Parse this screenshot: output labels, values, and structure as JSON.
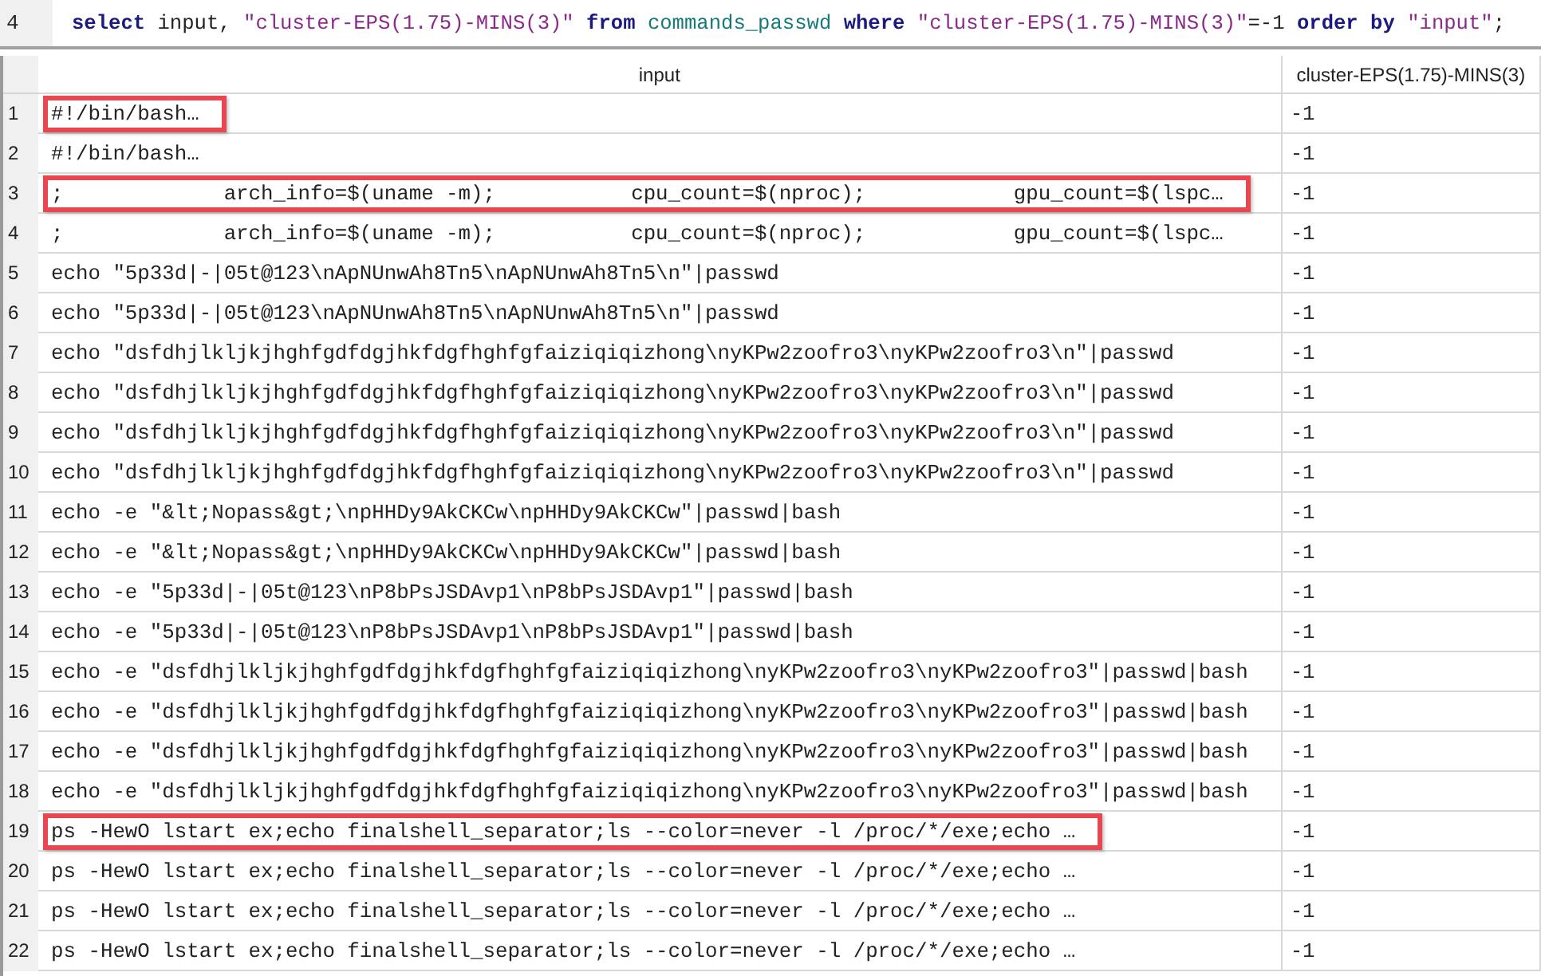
{
  "editor": {
    "line_number": "4",
    "tokens": [
      {
        "kind": "keyword",
        "text": "select"
      },
      {
        "kind": "plain",
        "text": " input, "
      },
      {
        "kind": "string",
        "text": "\"cluster-EPS(1.75)-MINS(3)\""
      },
      {
        "kind": "keyword",
        "text": " from"
      },
      {
        "kind": "ident",
        "text": " commands_passwd"
      },
      {
        "kind": "keyword",
        "text": " where"
      },
      {
        "kind": "string",
        "text": " \"cluster-EPS(1.75)-MINS(3)\""
      },
      {
        "kind": "plain",
        "text": "=-1 "
      },
      {
        "kind": "keyword",
        "text": "order by"
      },
      {
        "kind": "string",
        "text": " \"input\""
      },
      {
        "kind": "plain",
        "text": ";"
      }
    ]
  },
  "table": {
    "columns": [
      "input",
      "cluster-EPS(1.75)-MINS(3)"
    ],
    "rows": [
      {
        "number": "1",
        "input": "#!/bin/bash…",
        "value": "-1",
        "highlighted": true
      },
      {
        "number": "2",
        "input": "#!/bin/bash…",
        "value": "-1",
        "highlighted": false
      },
      {
        "number": "3",
        "input": ";             arch_info=$(uname -m);           cpu_count=$(nproc);            gpu_count=$(lspc…",
        "value": "-1",
        "highlighted": true
      },
      {
        "number": "4",
        "input": ";             arch_info=$(uname -m);           cpu_count=$(nproc);            gpu_count=$(lspc…",
        "value": "-1",
        "highlighted": false
      },
      {
        "number": "5",
        "input": "echo \"5p33d|-|05t@123\\nApNUnwAh8Tn5\\nApNUnwAh8Tn5\\n\"|passwd",
        "value": "-1",
        "highlighted": false
      },
      {
        "number": "6",
        "input": "echo \"5p33d|-|05t@123\\nApNUnwAh8Tn5\\nApNUnwAh8Tn5\\n\"|passwd",
        "value": "-1",
        "highlighted": false
      },
      {
        "number": "7",
        "input": "echo \"dsfdhjlkljkjhghfgdfdgjhkfdgfhghfgfaiziqiqizhong\\nyKPw2zoofro3\\nyKPw2zoofro3\\n\"|passwd",
        "value": "-1",
        "highlighted": false
      },
      {
        "number": "8",
        "input": "echo \"dsfdhjlkljkjhghfgdfdgjhkfdgfhghfgfaiziqiqizhong\\nyKPw2zoofro3\\nyKPw2zoofro3\\n\"|passwd",
        "value": "-1",
        "highlighted": false
      },
      {
        "number": "9",
        "input": "echo \"dsfdhjlkljkjhghfgdfdgjhkfdgfhghfgfaiziqiqizhong\\nyKPw2zoofro3\\nyKPw2zoofro3\\n\"|passwd",
        "value": "-1",
        "highlighted": false
      },
      {
        "number": "10",
        "input": "echo \"dsfdhjlkljkjhghfgdfdgjhkfdgfhghfgfaiziqiqizhong\\nyKPw2zoofro3\\nyKPw2zoofro3\\n\"|passwd",
        "value": "-1",
        "highlighted": false
      },
      {
        "number": "11",
        "input": "echo -e \"&lt;Nopass&gt;\\npHHDy9AkCKCw\\npHHDy9AkCKCw\"|passwd|bash",
        "value": "-1",
        "highlighted": false
      },
      {
        "number": "12",
        "input": "echo -e \"&lt;Nopass&gt;\\npHHDy9AkCKCw\\npHHDy9AkCKCw\"|passwd|bash",
        "value": "-1",
        "highlighted": false
      },
      {
        "number": "13",
        "input": "echo -e \"5p33d|-|05t@123\\nP8bPsJSDAvp1\\nP8bPsJSDAvp1\"|passwd|bash",
        "value": "-1",
        "highlighted": false
      },
      {
        "number": "14",
        "input": "echo -e \"5p33d|-|05t@123\\nP8bPsJSDAvp1\\nP8bPsJSDAvp1\"|passwd|bash",
        "value": "-1",
        "highlighted": false
      },
      {
        "number": "15",
        "input": "echo -e \"dsfdhjlkljkjhghfgdfdgjhkfdgfhghfgfaiziqiqizhong\\nyKPw2zoofro3\\nyKPw2zoofro3\"|passwd|bash",
        "value": "-1",
        "highlighted": false
      },
      {
        "number": "16",
        "input": "echo -e \"dsfdhjlkljkjhghfgdfdgjhkfdgfhghfgfaiziqiqizhong\\nyKPw2zoofro3\\nyKPw2zoofro3\"|passwd|bash",
        "value": "-1",
        "highlighted": false
      },
      {
        "number": "17",
        "input": "echo -e \"dsfdhjlkljkjhghfgdfdgjhkfdgfhghfgfaiziqiqizhong\\nyKPw2zoofro3\\nyKPw2zoofro3\"|passwd|bash",
        "value": "-1",
        "highlighted": false
      },
      {
        "number": "18",
        "input": "echo -e \"dsfdhjlkljkjhghfgdfdgjhkfdgfhghfgfaiziqiqizhong\\nyKPw2zoofro3\\nyKPw2zoofro3\"|passwd|bash",
        "value": "-1",
        "highlighted": false
      },
      {
        "number": "19",
        "input": "ps -HewO lstart ex;echo finalshell_separator;ls --color=never -l /proc/*/exe;echo …",
        "value": "-1",
        "highlighted": true
      },
      {
        "number": "20",
        "input": "ps -HewO lstart ex;echo finalshell_separator;ls --color=never -l /proc/*/exe;echo …",
        "value": "-1",
        "highlighted": false
      },
      {
        "number": "21",
        "input": "ps -HewO lstart ex;echo finalshell_separator;ls --color=never -l /proc/*/exe;echo …",
        "value": "-1",
        "highlighted": false
      },
      {
        "number": "22",
        "input": "ps -HewO lstart ex;echo finalshell_separator;ls --color=never -l /proc/*/exe;echo …",
        "value": "-1",
        "highlighted": false
      }
    ]
  }
}
